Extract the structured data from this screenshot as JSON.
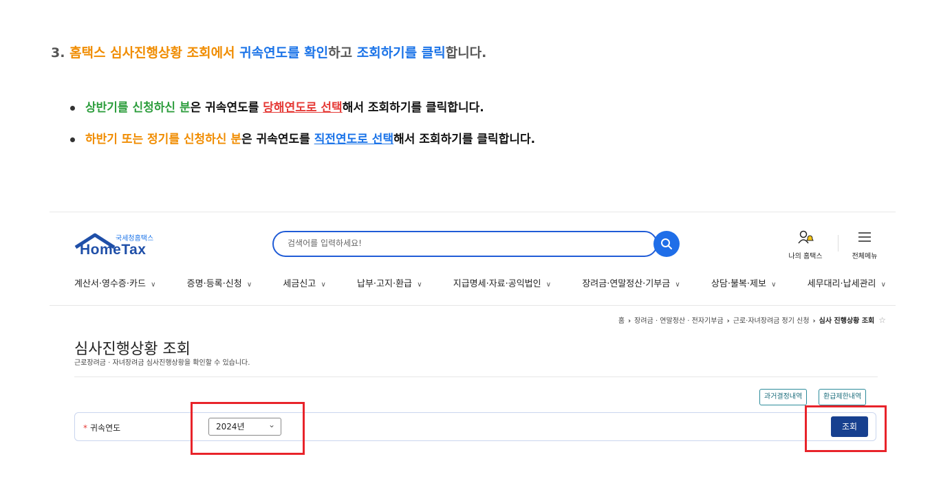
{
  "instruction": {
    "prefix": "3. ",
    "part1": "홈택스 심사진행상황 조회에서",
    "part2": " ",
    "part3": "귀속연도를 확인",
    "part4": "하고 ",
    "part5": "조회하기를 클릭",
    "part6": "합니다."
  },
  "bullets": [
    {
      "lead": "상반기를 신청하신 분",
      "mid": "은 귀속연도를 ",
      "link": "당해연도로 선택",
      "tail": "해서 조회하기를 클릭합니다."
    },
    {
      "lead": "하반기 또는 정기를 신청하신 분",
      "mid": "은 귀속연도를 ",
      "link": "직전연도로 선택",
      "tail": "해서 조회하기를 클릭합니다."
    }
  ],
  "header": {
    "logo_kr": "국세청홈택스",
    "logo_en": "HomeTax",
    "search_placeholder": "검색어를 입력하세요!",
    "my_hometax": "나의 홈택스",
    "all_menu": "전체메뉴"
  },
  "gnb": [
    "계산서·영수증·카드",
    "증명·등록·신청",
    "세금신고",
    "납부·고지·환급",
    "지급명세·자료·공익법인",
    "장려금·연말정산·기부금",
    "상담·불복·제보",
    "세무대리·납세관리"
  ],
  "breadcrumb": [
    "홈",
    "장려금 · 연말정산 · 전자기부금",
    "근로·자녀장려금 정기 신청",
    "심사 진행상황 조회"
  ],
  "page": {
    "title": "심사진행상황 조회",
    "subtitle": "근로장려금 · 자녀장려금 심사진행상황을 확인할 수 있습니다."
  },
  "buttons": {
    "past_decision": "과거결정내역",
    "refund_limit": "환급제한내역",
    "query": "조회"
  },
  "form": {
    "required_mark": "*",
    "year_label": "귀속연도",
    "year_value": "2024년"
  },
  "colors": {
    "accent_blue": "#1a73e8",
    "highlight_orange": "#f08c00",
    "highlight_green": "#2e9e3e",
    "annotation_red": "#e8232a",
    "query_button": "#17408f"
  }
}
